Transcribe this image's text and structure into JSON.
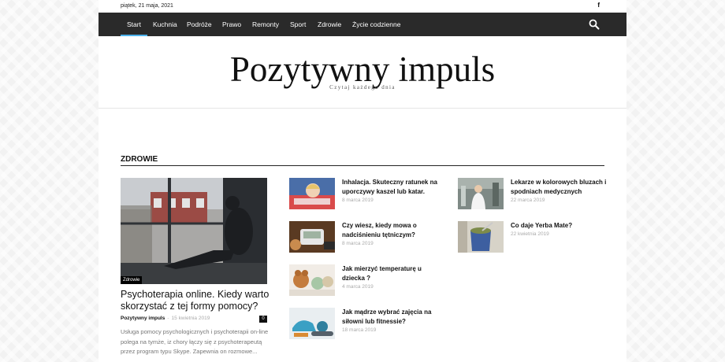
{
  "topbar": {
    "date": "piątek, 21 maja, 2021",
    "social_icon": "f"
  },
  "nav": {
    "items": [
      "Start",
      "Kuchnia",
      "Podróże",
      "Prawo",
      "Remonty",
      "Sport",
      "Zdrowie",
      "Życie codzienne"
    ],
    "active": "Start",
    "search_icon": "search-icon"
  },
  "header": {
    "title": "Pozytywny impuls",
    "tagline": "Czytaj każdego dnia"
  },
  "section": {
    "title": "ZDROWIE"
  },
  "featured": {
    "category": "Zdrowie",
    "title": "Psychoterapia online. Kiedy warto skorzystać z tej formy pomocy?",
    "author": "Pozytywny impuls",
    "separator": "-",
    "date": "15 kwietnia 2019",
    "comments": "0",
    "excerpt": "Usługa pomocy psychologicznych i psychoterapii on-line polega na tymże, iz chory łączy się z psychoterapeutą przez program typu Skype. Zapewnia on rozmowe..."
  },
  "posts": [
    {
      "title": "Inhalacja. Skuteczny ratunek na uporczywy kaszel lub katar.",
      "date": "8 marca 2019"
    },
    {
      "title": "Czy wiesz, kiedy mowa o nadciśnieniu tętniczym?",
      "date": "8 marca 2019"
    },
    {
      "title": "Jak mierzyć temperaturę u dziecka ?",
      "date": "4 marca 2019"
    },
    {
      "title": "Jak mądrze wybrać zajęcia na siłowni lub fitnessie?",
      "date": "18 marca 2019"
    },
    {
      "title": "Lekarze w kolorowych bluzach i spodniach medycznych",
      "date": "22 marca 2019"
    },
    {
      "title": "Co daje Yerba Mate?",
      "date": "22 kwietnia 2019"
    }
  ],
  "colors": {
    "nav_bg": "#2a2a2a",
    "accent": "#4db2ec",
    "page_bg": "#f2f2f2"
  }
}
